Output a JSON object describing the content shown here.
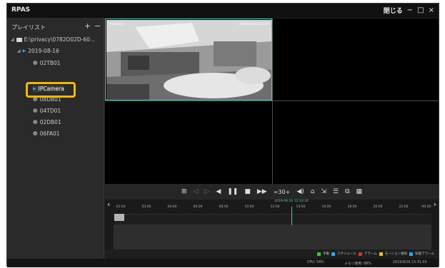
{
  "app": {
    "title": "RPAS",
    "close_label": "閉じる",
    "minimize": "−",
    "maximize": "□",
    "close": "×"
  },
  "sidebar": {
    "heading": "プレイリスト",
    "add": "+",
    "remove": "−",
    "tree": {
      "root": "E:\\privacy\\0782D02D-60...",
      "date": "2019-08-16",
      "items": [
        "02TB01",
        "IPCamera",
        "08DB01",
        "04TD01",
        "02DB01",
        "06FA01"
      ],
      "selected": "IPCamera"
    }
  },
  "video": {
    "cam_label": "IPCamera",
    "cam_timestamp": "2019-08-16 12:33:35"
  },
  "controls": {
    "speed": "=30+"
  },
  "timeline": {
    "ticks": [
      "02:00",
      "03:00",
      "04:00",
      "06:00",
      "08:00",
      "10:00",
      "12:00",
      "14:00",
      "16:00",
      "18:00",
      "20:00",
      "22:00",
      "00:00"
    ],
    "cursor_label": "2019-08-16 12:33:32"
  },
  "legend": [
    {
      "label": "手動",
      "color": "#3cc43c"
    },
    {
      "label": "スケジュール",
      "color": "#2ea8e8"
    },
    {
      "label": "アラーム",
      "color": "#d83030"
    },
    {
      "label": "モーション検知",
      "color": "#e8c020"
    },
    {
      "label": "知能アラーム",
      "color": "#2ea8e8"
    }
  ],
  "status": {
    "cpu": "CPU: 54%",
    "memory": "メモリ使用: 68%",
    "datetime": "2019/9/16 15:31:03"
  },
  "colors": {
    "accent": "#41d2c8",
    "highlight": "#f5b800"
  }
}
